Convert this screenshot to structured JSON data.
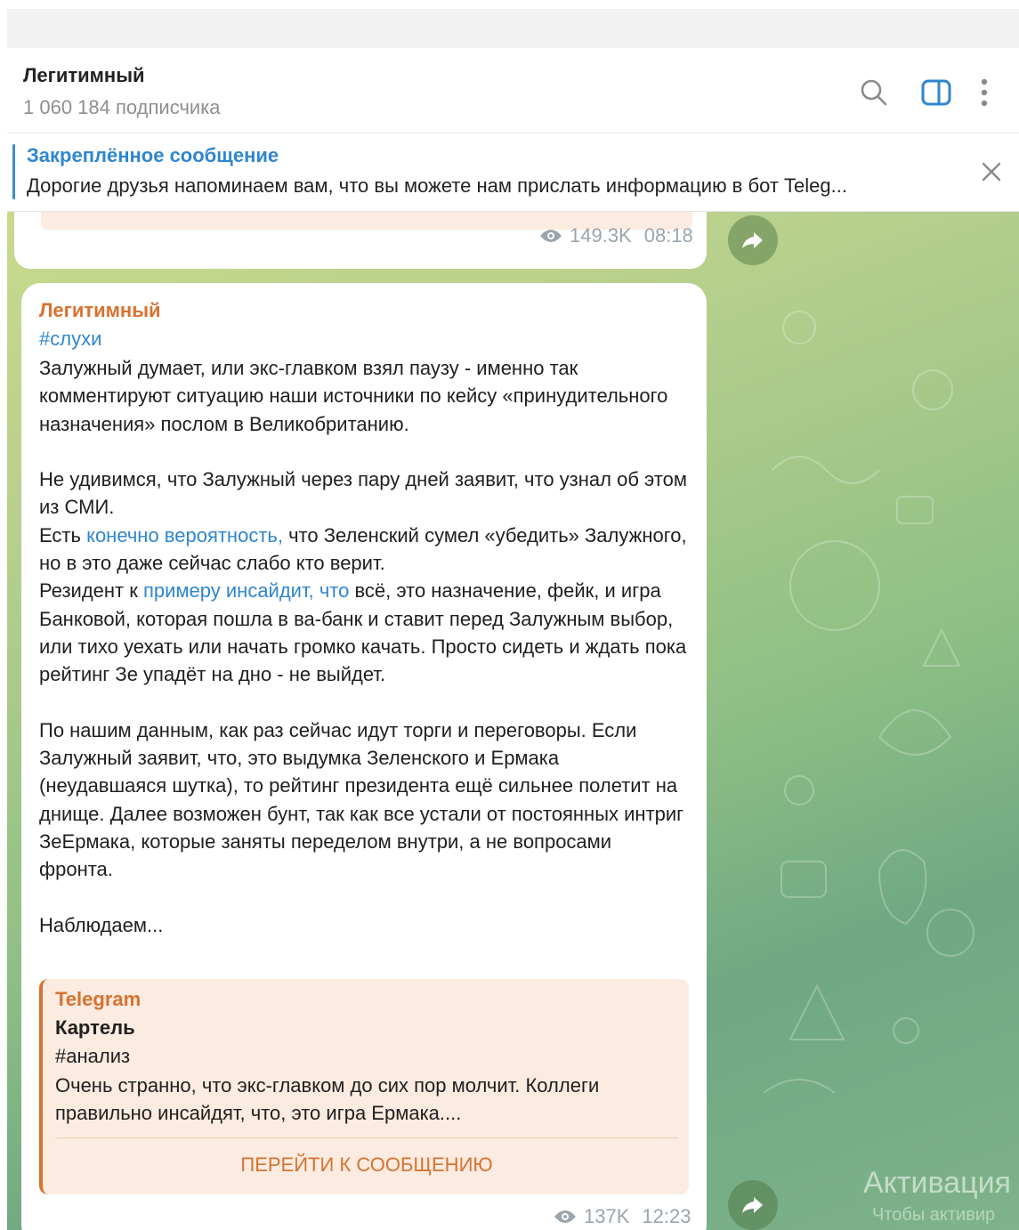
{
  "header": {
    "channel_name": "Легитимный",
    "subscribers": "1 060 184 подписчика",
    "icons": [
      "search-icon",
      "sidebar-toggle-icon",
      "more-icon"
    ]
  },
  "pinned": {
    "label": "Закреплённое сообщение",
    "text": "Дорогие друзья напоминаем вам, что вы можете нам прислать информацию в бот Teleg...",
    "close_icon": "close-icon"
  },
  "previous_message": {
    "views": "149.3K",
    "time": "08:18"
  },
  "message": {
    "author": "Легитимный",
    "hashtag": "#слухи",
    "p1": "Залужный думает, или экс-главком взял паузу - именно так комментируют ситуацию наши источники по кейсу «принудительного назначения» послом в Великобританию.",
    "p2": "Не удивимся, что Залужный через пару дней заявит, что узнал об этом из СМИ.",
    "p3_a": "Есть ",
    "p3_link": "конечно вероятность,",
    "p3_b": " что Зеленский сумел «убедить» Залужного, но в это даже сейчас слабо кто верит.",
    "p4_a": "Резидент к ",
    "p4_link": "примеру инсайдит, что",
    "p4_b": " всё, это назначение, фейк, и игра Банковой, которая пошла в ва-банк и ставит перед Залужным выбор, или тихо уехать или начать громко качать. Просто сидеть и ждать пока рейтинг Зе упадёт на дно - не выйдет.",
    "p5": "По нашим данным, как раз сейчас идут торги и переговоры. Если Залужный заявит, что, это выдумка Зеленского и Ермака (неудавшаяся шутка), то рейтинг президента ещё сильнее полетит на днище. Далее возможен бунт, так как все устали от постоянных интриг ЗеЕрмака, которые заняты переделом внутри, а не вопросами фронта.",
    "p6": "Наблюдаем...",
    "quote": {
      "source": "Telegram",
      "title": "Картель",
      "tag": "#анализ",
      "text": "Очень странно, что экс-главком до сих пор молчит. Коллеги правильно инсайдят, что, это игра Ермака....",
      "button": "ПЕРЕЙТИ К СООБЩЕНИЮ"
    },
    "views": "137K",
    "time": "12:23"
  },
  "overlay": {
    "watermark": "Активация",
    "watermark_sub": "Чтобы активир"
  },
  "colors": {
    "accent_blue": "#2f86cf",
    "author_orange": "#d8722f",
    "quote_bg": "#fcebe0"
  }
}
